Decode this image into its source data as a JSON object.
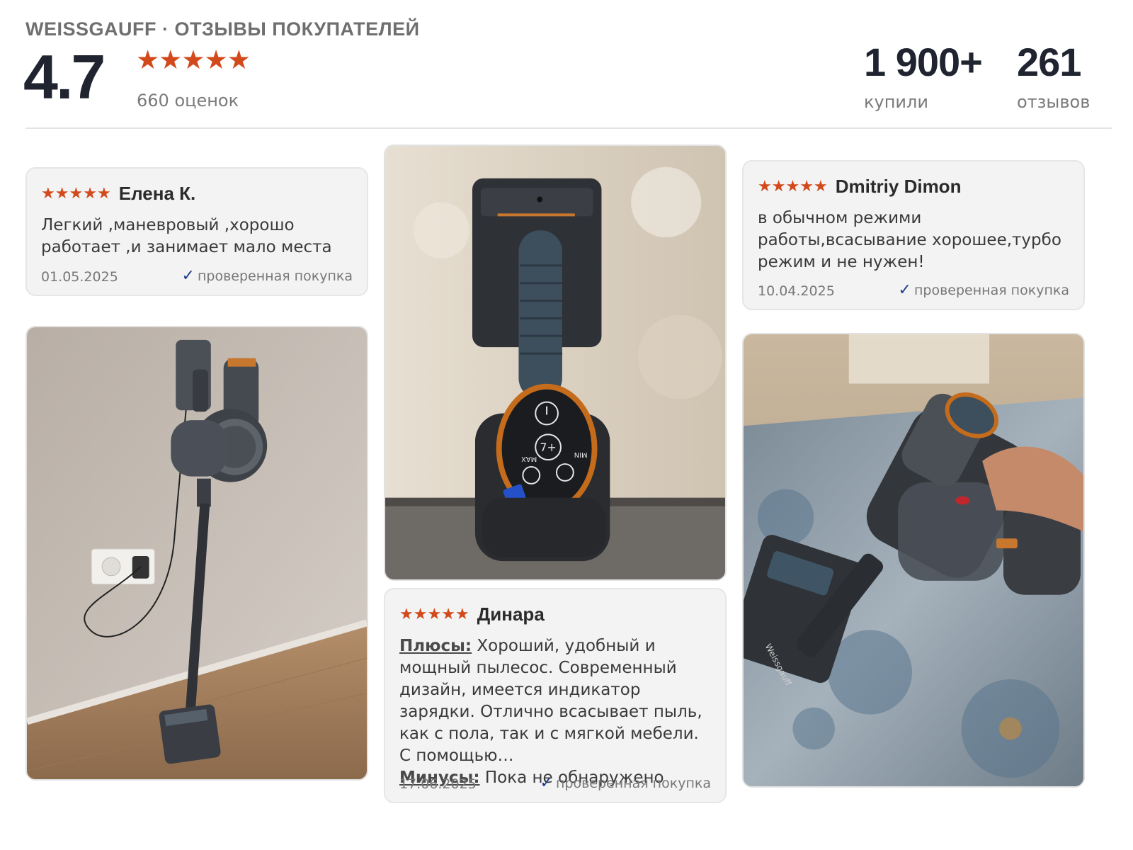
{
  "header": {
    "brand": "WEISSGAUFF · ОТЗЫВЫ ПОКУПАТЕЛЕЙ",
    "rating": "4.7",
    "rating_stars": 5,
    "ratings_count": "660 оценок",
    "bought_value": "1 900+",
    "bought_label": "купили",
    "reviews_value": "261",
    "reviews_label": "отзывов"
  },
  "colors": {
    "star": "#d24a1c",
    "check": "#1d3f8a",
    "card_bg": "#f3f3f3"
  },
  "reviews": [
    {
      "author": "Елена К.",
      "stars": 5,
      "text": "Легкий ,маневровый ,хорошо работает ,и занимает мало места",
      "date": "01.05.2025",
      "verified": "проверенная покупка"
    },
    {
      "author": "Dmitriy Dimon",
      "stars": 5,
      "text": "в обычном режими работы,всасывание хорошее,турбо режим и не нужен!",
      "date": "10.04.2025",
      "verified": "проверенная покупка"
    },
    {
      "author": "Динара",
      "stars": 5,
      "pros_label": "Плюсы:",
      "pros_text": " Хороший, удобный и мощный пылесос. Современный дизайн, имеется индикатор зарядки. Отлично всасывает пыль, как с пола, так и с мягкой мебели. С помощью…",
      "cons_label": "Минусы:",
      "cons_text": " Пока не обнаружено",
      "date": "17.06.2025",
      "verified": "проверенная покупка"
    }
  ],
  "photos": {
    "control_panel_labels": {
      "max": "MAX",
      "min": "MIN",
      "boost": "7+"
    },
    "brand_on_nozzle": "Weissgauff"
  },
  "icons": {
    "star": "star-icon",
    "check": "check-icon"
  }
}
